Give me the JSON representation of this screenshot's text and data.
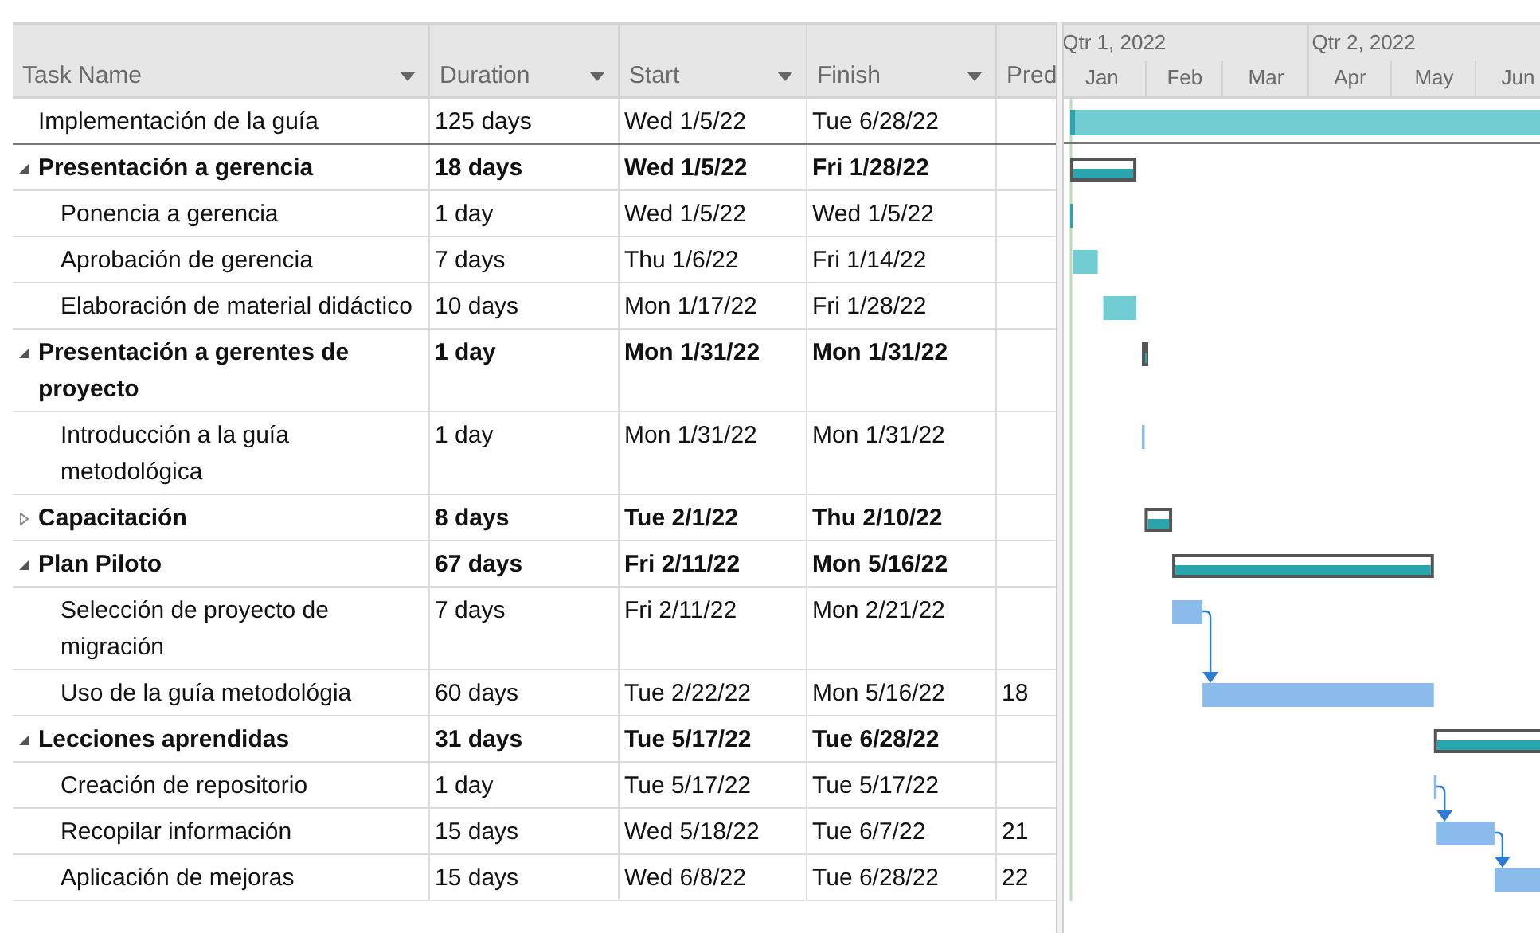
{
  "columns": [
    {
      "label": "Task Name"
    },
    {
      "label": "Duration"
    },
    {
      "label": "Start"
    },
    {
      "label": "Finish"
    },
    {
      "label": "Pred"
    }
  ],
  "timescale": {
    "quarters": [
      "Qtr 1, 2022",
      "Qtr 2, 2022"
    ],
    "months": [
      "Jan",
      "Feb",
      "Mar",
      "Apr",
      "May",
      "Jun"
    ]
  },
  "project": {
    "name": "Implementación de la guía",
    "duration": "125 days",
    "start": "Wed 1/5/22",
    "finish": "Tue 6/28/22"
  },
  "tasks": [
    {
      "kind": "summary",
      "name": "Presentación a gerencia",
      "duration": "18 days",
      "start": "Wed 1/5/22",
      "finish": "Fri 1/28/22",
      "expanded": true,
      "children": [
        {
          "kind": "task",
          "name": "Ponencia a gerencia",
          "duration": "1 day",
          "start": "Wed 1/5/22",
          "finish": "Wed 1/5/22",
          "color": "#2ba5ad"
        },
        {
          "kind": "task",
          "name": "Aprobación de gerencia",
          "duration": "7 days",
          "start": "Thu 1/6/22",
          "finish": "Fri 1/14/22",
          "color": "#72cdd3"
        },
        {
          "kind": "task",
          "name": "Elaboración de material didáctico",
          "duration": "10 days",
          "start": "Mon 1/17/22",
          "finish": "Fri 1/28/22",
          "color": "#72cdd3"
        }
      ]
    },
    {
      "kind": "summary",
      "name": "Presentación a gerentes de proyecto",
      "duration": "1 day",
      "start": "Mon 1/31/22",
      "finish": "Mon 1/31/22",
      "expanded": true,
      "children": [
        {
          "kind": "task",
          "name": "Introducción a la guía metodológica",
          "duration": "1 day",
          "start": "Mon 1/31/22",
          "finish": "Mon 1/31/22",
          "color": "#8bbbea"
        }
      ]
    },
    {
      "kind": "summary",
      "name": "Capacitación",
      "duration": "8 days",
      "start": "Tue 2/1/22",
      "finish": "Thu 2/10/22",
      "expanded": false
    },
    {
      "kind": "summary",
      "name": "Plan Piloto",
      "duration": "67 days",
      "start": "Fri 2/11/22",
      "finish": "Mon 5/16/22",
      "expanded": true,
      "children": [
        {
          "kind": "task",
          "name": "Selección de proyecto de migración",
          "duration": "7 days",
          "start": "Fri 2/11/22",
          "finish": "Mon 2/21/22",
          "color": "#8bbbea"
        },
        {
          "kind": "task",
          "name": "Uso de la guía metodológia",
          "duration": "60 days",
          "start": "Tue 2/22/22",
          "finish": "Mon 5/16/22",
          "pred": "18",
          "color": "#8bbbea"
        }
      ]
    },
    {
      "kind": "summary",
      "name": "Lecciones aprendidas",
      "duration": "31 days",
      "start": "Tue 5/17/22",
      "finish": "Tue 6/28/22",
      "expanded": true,
      "children": [
        {
          "kind": "task",
          "name": "Creación de repositorio",
          "duration": "1 day",
          "start": "Tue 5/17/22",
          "finish": "Tue 5/17/22",
          "color": "#8bbbea"
        },
        {
          "kind": "task",
          "name": "Recopilar información",
          "duration": "15 days",
          "start": "Wed 5/18/22",
          "finish": "Tue 6/7/22",
          "pred": "21",
          "color": "#8bbbea"
        },
        {
          "kind": "task",
          "name": "Aplicación de mejoras",
          "duration": "15 days",
          "start": "Wed 6/8/22",
          "finish": "Tue 6/28/22",
          "pred": "22",
          "color": "#8bbbea"
        }
      ]
    }
  ]
}
